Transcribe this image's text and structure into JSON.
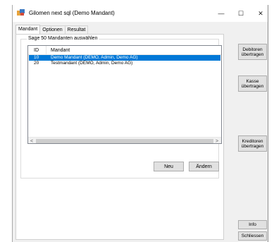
{
  "window": {
    "title": "Gilomen next sql (Demo Mandant)",
    "controls": {
      "minimize": "—",
      "maximize": "☐",
      "close": "✕"
    }
  },
  "tabs": [
    {
      "label": "Mandant",
      "active": true
    },
    {
      "label": "Optionen",
      "active": false
    },
    {
      "label": "Resultat",
      "active": false
    }
  ],
  "group": {
    "legend": "Sage 50 Mandanten auswählen"
  },
  "list": {
    "columns": [
      "ID",
      "Mandant"
    ],
    "rows": [
      {
        "id": "10",
        "name": "Demo Mandant  (DEMO, Admin, Demo AG)",
        "selected": true
      },
      {
        "id": "20",
        "name": "Testmandant  (DEMO, Admin, Demo AG)",
        "selected": false
      }
    ]
  },
  "buttons": {
    "neu": "Neu",
    "aendern": "Ändern",
    "debitoren": "Debitoren\nübertragen",
    "kasse": "Kasse\nübertragen",
    "kreditoren": "Kreditoren\nübertragen",
    "info": "Info",
    "schliessen": "Schliessen"
  },
  "scrollbar": {
    "left_arrow": "<",
    "right_arrow": ">"
  },
  "colors": {
    "selection": "#0078d7",
    "window_bg": "#f0f0f0"
  }
}
